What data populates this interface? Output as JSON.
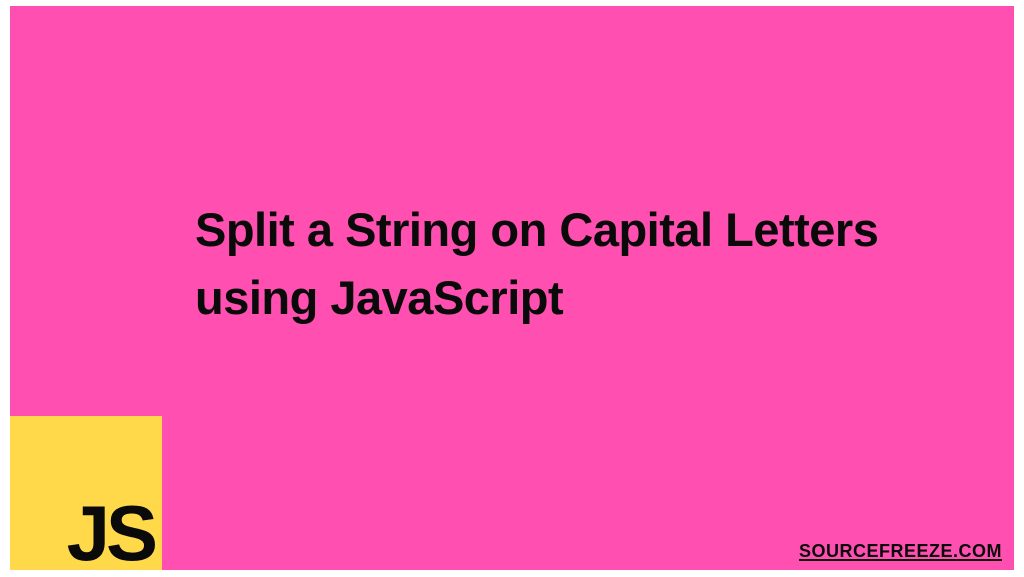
{
  "headline": "Split a String on Capital Letters using JavaScript",
  "logo": {
    "text": "JS"
  },
  "watermark": "SOURCEFREEZE.COM"
}
